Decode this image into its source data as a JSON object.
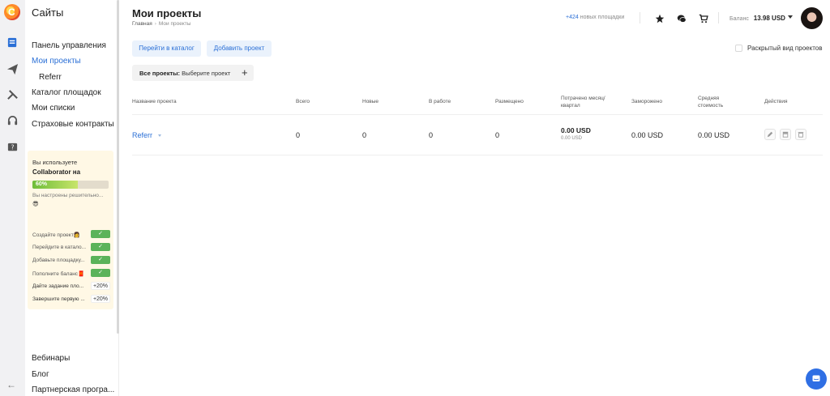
{
  "sidebar": {
    "title": "Сайты",
    "items": [
      {
        "label": "Панель управления"
      },
      {
        "label": "Мои проекты"
      },
      {
        "label": "Referr"
      },
      {
        "label": "Каталог площадок"
      },
      {
        "label": "Мои списки"
      },
      {
        "label": "Страховые контракты"
      }
    ],
    "bottom": [
      {
        "label": "Вебинары"
      },
      {
        "label": "Блог"
      },
      {
        "label": "Партнерская програ..."
      }
    ]
  },
  "onboarding": {
    "line1": "Вы используете",
    "line2": "Collaborator на",
    "progress_label": "60%",
    "progress_value": 0.6,
    "note": "Вы настроены решительно...",
    "note_emoji": "😎",
    "tasks": [
      {
        "label": "Создайте проект👩",
        "badge": "✓"
      },
      {
        "label": "Перейдите в катало...",
        "badge": "✓"
      },
      {
        "label": "Добавьте площадку...",
        "badge": "✓"
      },
      {
        "label": "Пополните баланс🧧",
        "badge": "✓"
      },
      {
        "label": "Дайте задание пло...",
        "badge": "+20%"
      },
      {
        "label": "Завершите первую ...",
        "badge": "+20%"
      }
    ]
  },
  "header": {
    "title": "Мои проекты",
    "breadcrumb_home": "Главная",
    "breadcrumb_sep": "›",
    "breadcrumb_current": "Мои проекты",
    "new_sites_count": "+424",
    "new_sites_label": "новых площадки",
    "balance_label": "Баланс",
    "balance_value": "13.98 USD"
  },
  "actions": {
    "catalog_button": "Перейти в каталог",
    "add_project_button": "Добавить проект",
    "expanded_view_label": "Раскрытый вид проектов",
    "filter_prefix": "Все проекты:",
    "filter_value": "Выберите проект",
    "filter_add": "+"
  },
  "table": {
    "columns": [
      "Название проекта",
      "Всего",
      "Новые",
      "В работе",
      "Размещено",
      "Потрачено месяц/квартал",
      "Заморожено",
      "Средняя стоимость",
      "Действия"
    ],
    "rows": [
      {
        "name": "Referr",
        "total": "0",
        "new": "0",
        "in_work": "0",
        "placed": "0",
        "spent_month": "0.00 USD",
        "spent_quarter": "0.00 USD",
        "frozen": "0.00 USD",
        "avg_cost": "0.00 USD"
      }
    ]
  },
  "colors": {
    "accent": "#2a6fd6",
    "button_bg": "#eaf2fc",
    "success": "#5bb35a",
    "onboarding_bg": "#fff8e5"
  }
}
